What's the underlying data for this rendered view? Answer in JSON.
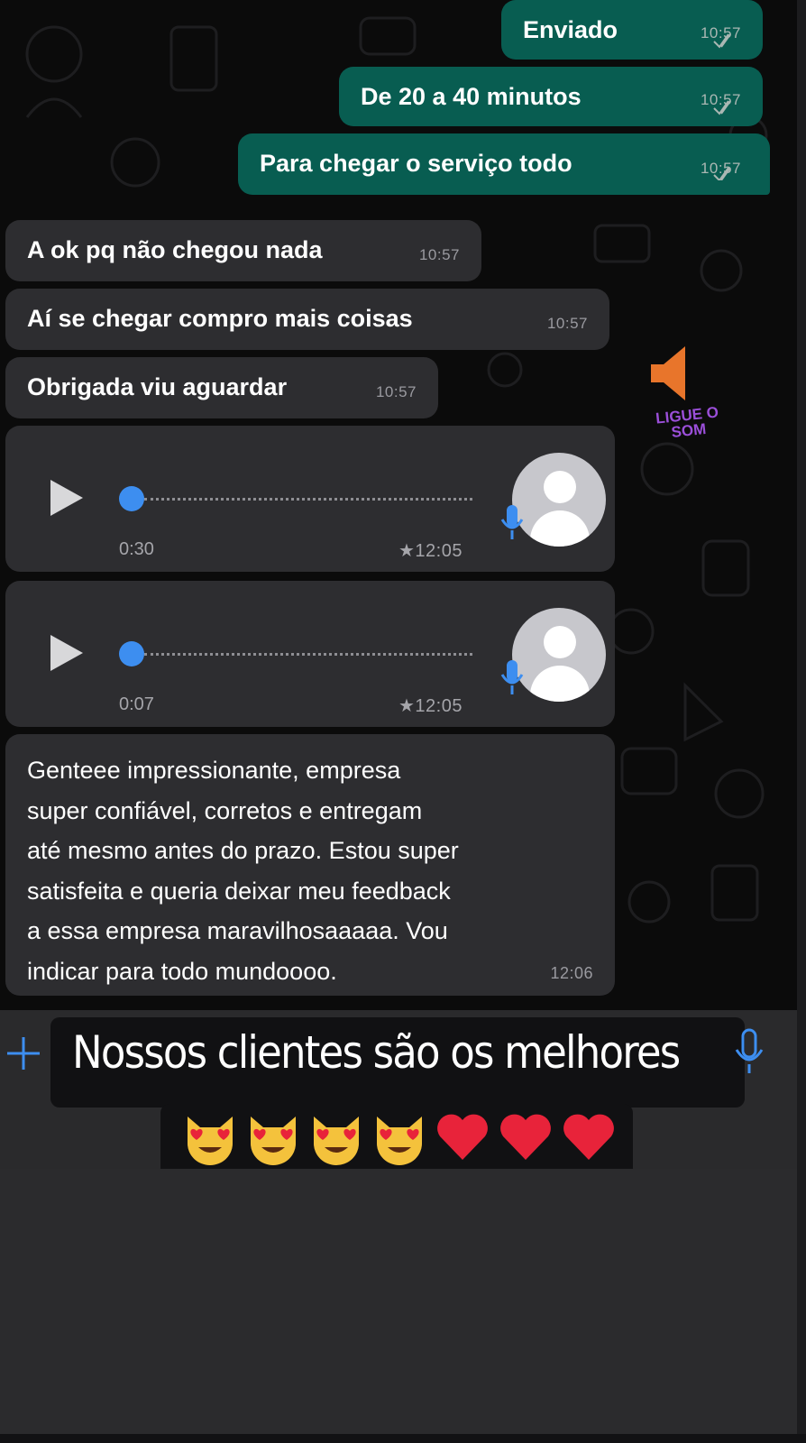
{
  "messages_out": [
    {
      "text": "Enviado",
      "time": "10:57"
    },
    {
      "text": "De 20 a 40 minutos",
      "time": "10:57"
    },
    {
      "text": "Para chegar o serviço todo",
      "time": "10:57"
    }
  ],
  "messages_in": [
    {
      "text": "A ok pq não chegou nada",
      "time": "10:57"
    },
    {
      "text": "Aí se chegar compro mais coisas",
      "time": "10:57"
    },
    {
      "text": "Obrigada viu aguardar",
      "time": "10:57"
    }
  ],
  "voice_notes": [
    {
      "duration": "0:30",
      "time": "★12:05"
    },
    {
      "duration": "0:07",
      "time": "★12:05"
    }
  ],
  "feedback": {
    "lines": [
      "Genteee impressionante, empresa",
      "super confiável, corretos e entregam",
      "até mesmo antes do prazo. Estou super",
      "satisfeita e queria deixar meu feedback",
      "a essa empresa maravilhosaaaaa. Vou",
      "indicar para todo mundoooo."
    ],
    "time": "12:06"
  },
  "sound_hint": "Ligue o som",
  "caption": "Nossos clientes são os melhores",
  "emoji_caption": [
    "heart-eyes-cat",
    "heart-eyes-cat",
    "heart-eyes-cat",
    "heart-eyes-cat",
    "red-heart",
    "red-heart",
    "red-heart"
  ],
  "colors": {
    "outgoing_bubble": "#085d51",
    "incoming_bubble": "#2d2d30",
    "voice_progress": "#3d8ef0",
    "sound_hint": "#9b4fd9"
  }
}
